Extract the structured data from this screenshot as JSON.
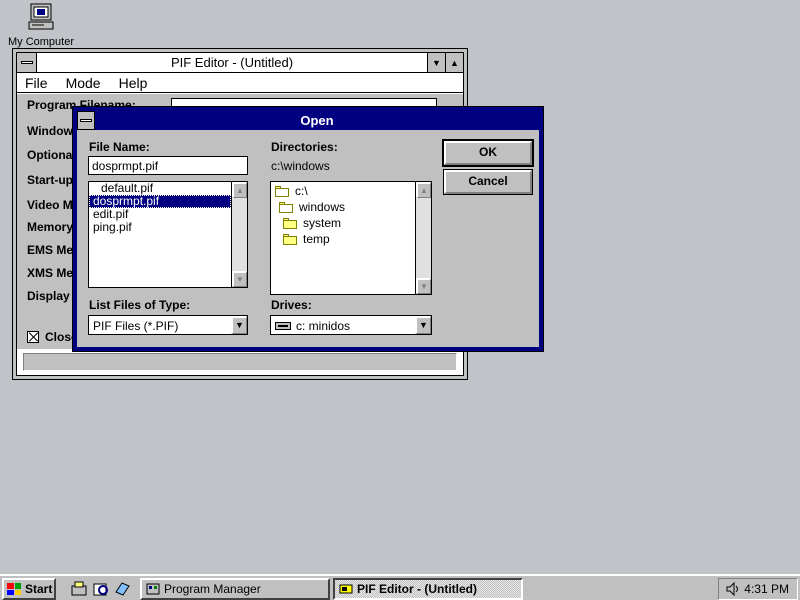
{
  "desktop": {
    "icon_label": "My Computer",
    "background": "#c0c4c8"
  },
  "pif_window": {
    "title": "PIF Editor - (Untitled)",
    "menu": [
      "File",
      "Mode",
      "Help"
    ],
    "fields": [
      "Program Filename:",
      "Window",
      "Optiona",
      "Start-up",
      "Video M",
      "Memory",
      "EMS Me",
      "XMS Me",
      "Display"
    ],
    "close_checkbox_label": "Close"
  },
  "open_dialog": {
    "title": "Open",
    "file_name_label": "File Name:",
    "file_name_value": "dosprmpt.pif",
    "files": [
      "default.pif",
      "dosprmpt.pif",
      "edit.pif",
      "ping.pif"
    ],
    "selected_file_index": 1,
    "directories_label": "Directories:",
    "current_directory": "c:\\windows",
    "directories": [
      "c:\\",
      "windows",
      "system",
      "temp"
    ],
    "list_type_label": "List Files of Type:",
    "list_type_value": "PIF Files (*.PIF)",
    "drives_label": "Drives:",
    "drive_value": "c: minidos",
    "ok_label": "OK",
    "cancel_label": "Cancel",
    "title_color": "#000080"
  },
  "taskbar": {
    "start_label": "Start",
    "tasks": [
      {
        "label": "Program Manager",
        "active": false
      },
      {
        "label": "PIF Editor - (Untitled)",
        "active": true
      }
    ],
    "clock": "4:31 PM"
  }
}
